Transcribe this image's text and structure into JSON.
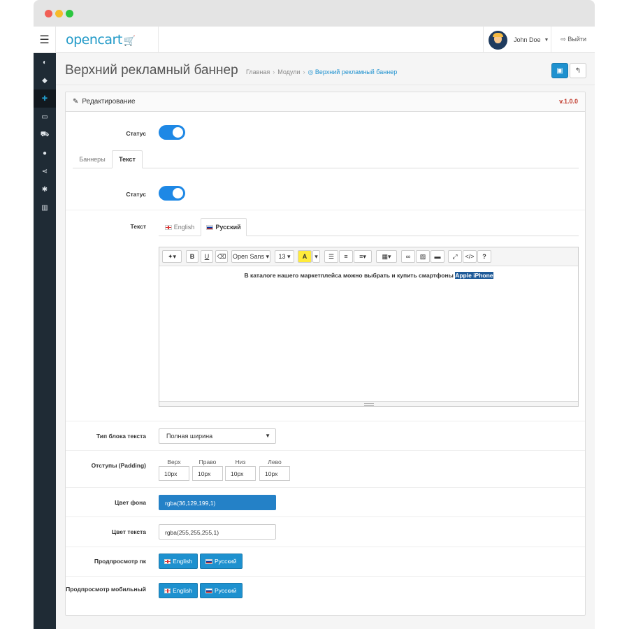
{
  "header": {
    "logo": "opencart",
    "logo_cart": "🛒",
    "user_name": "John Doe",
    "logout_label": "Выйти"
  },
  "page": {
    "title": "Верхний рекламный баннер",
    "breadcrumb": [
      "Главная",
      "Модули",
      "Верхний рекламный баннер"
    ]
  },
  "panel": {
    "heading": "Редактирование",
    "version": "v.1.0.0"
  },
  "form": {
    "status_label": "Статус",
    "tabs": [
      "Баннеры",
      "Текст"
    ],
    "active_tab": "Текст",
    "text_status_label": "Статус",
    "text_label": "Текст",
    "lang_tabs": [
      "English",
      "Русский"
    ],
    "active_lang": "Русский",
    "editor": {
      "toolbar_font": "Open Sans",
      "toolbar_size": "13",
      "content_plain": "В каталоге нашего маркетплейса можно выбрать и купить смартфоны ",
      "content_highlighted": "Apple iPhone"
    },
    "block_type_label": "Тип блока текста",
    "block_type_value": "Полная ширина",
    "padding_label": "Отступы (Padding)",
    "padding": [
      {
        "label": "Верх",
        "value": "10px"
      },
      {
        "label": "Право",
        "value": "10px"
      },
      {
        "label": "Низ",
        "value": "10px"
      },
      {
        "label": "Лево",
        "value": "10px"
      }
    ],
    "bg_color_label": "Цвет фона",
    "bg_color_value": "rgba(36,129,199,1)",
    "text_color_label": "Цвет текста",
    "text_color_value": "rgba(255,255,255,1)",
    "preview_pc_label": "Продпросмотр пк",
    "preview_mobile_label": "Продпросмотр мобильный",
    "preview_buttons": [
      "English",
      "Русский"
    ]
  },
  "colors": {
    "accent": "#1e91cf",
    "sidebar": "#1f2b35",
    "toggle": "#1e88e5",
    "bg_swatch": "#2481c7",
    "version": "#c0392b"
  }
}
